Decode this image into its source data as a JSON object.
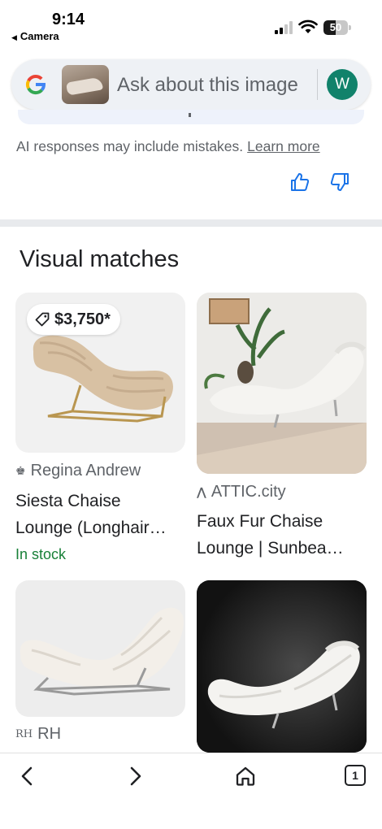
{
  "status": {
    "time": "9:14",
    "back_app": "Camera",
    "battery": "50",
    "battery_level": 0.5
  },
  "search": {
    "placeholder": "Ask about this image",
    "avatar_letter": "W"
  },
  "ai": {
    "disclaimer": "AI responses may include mistakes.",
    "learn_more": "Learn more"
  },
  "section_title": "Visual matches",
  "results": [
    {
      "price": "$3,750*",
      "source": "Regina Andrew",
      "title_line1": "Siesta Chaise",
      "title_line2": "Lounge (Longhair…",
      "stock": "In stock"
    },
    {
      "source": "ATTIC.city",
      "title_line1": "Faux Fur Chaise",
      "title_line2": "Lounge | Sunbea…"
    },
    {
      "source": "RH"
    },
    {}
  ],
  "colors": {
    "avatar": "#11826b",
    "in_stock": "#188038",
    "search_bg": "#eef1f5",
    "link_blue": "#1a73e8"
  },
  "icons": [
    "google-logo",
    "thumbs-up-icon",
    "thumbs-down-icon",
    "price-tag-icon",
    "back-icon",
    "forward-icon",
    "home-icon",
    "tabs-icon"
  ],
  "toolbar": {
    "tab_count": "1"
  }
}
